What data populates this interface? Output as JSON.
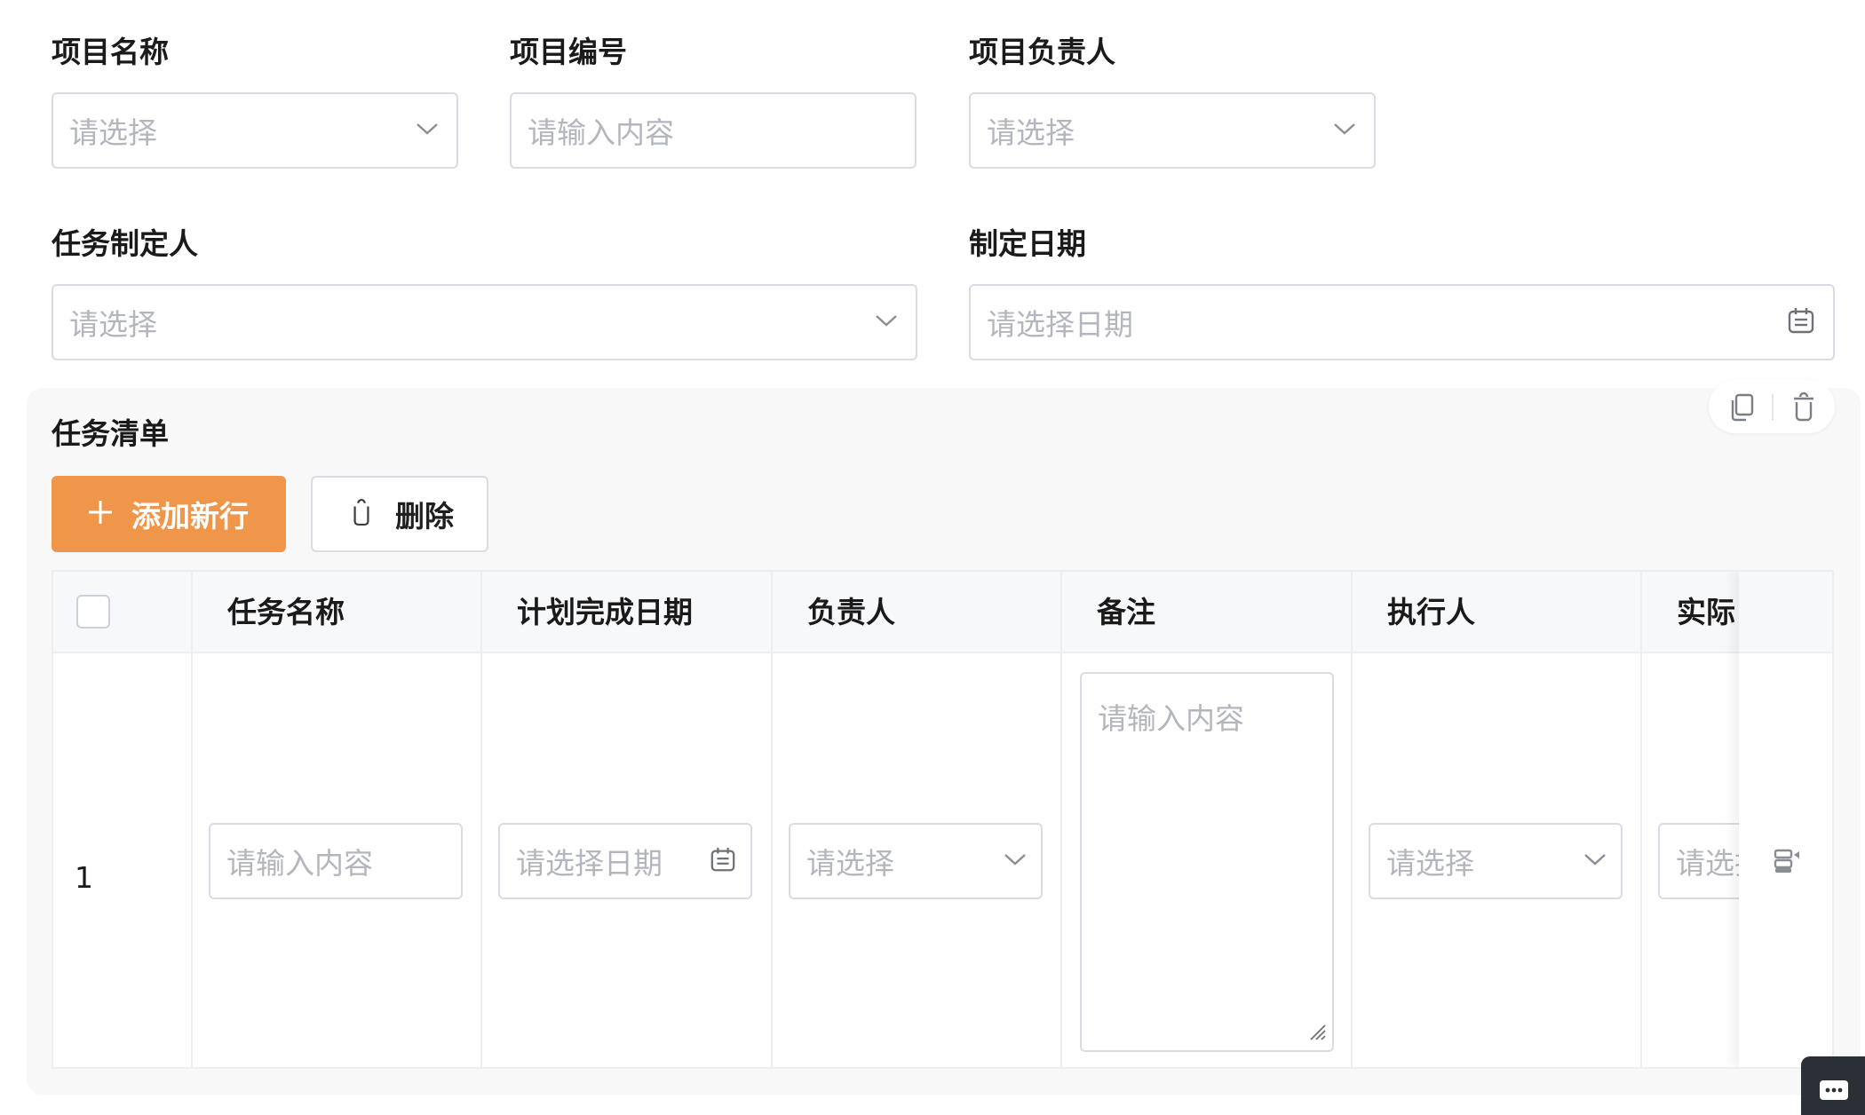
{
  "form": {
    "project_name": {
      "label": "项目名称",
      "placeholder": "请选择"
    },
    "project_code": {
      "label": "项目编号",
      "placeholder": "请输入内容"
    },
    "project_owner": {
      "label": "项目负责人",
      "placeholder": "请选择"
    },
    "task_creator": {
      "label": "任务制定人",
      "placeholder": "请选择"
    },
    "create_date": {
      "label": "制定日期",
      "placeholder": "请选择日期"
    }
  },
  "task_list": {
    "title": "任务清单",
    "add_button": "添加新行",
    "delete_button": "删除",
    "columns": [
      "任务名称",
      "计划完成日期",
      "负责人",
      "备注",
      "执行人",
      "实际"
    ],
    "rows": [
      {
        "index": "1",
        "task_name_placeholder": "请输入内容",
        "plan_date_placeholder": "请选择日期",
        "owner_placeholder": "请选择",
        "remark_placeholder": "请输入内容",
        "executor_placeholder": "请选择",
        "actual_placeholder": "请选择"
      }
    ]
  },
  "colors": {
    "accent": "#f0964a",
    "border": "#d9dce3",
    "placeholder": "#b3b6bd",
    "card_bg": "#f8f8f9"
  },
  "icons": [
    "chevron-down-icon",
    "calendar-icon",
    "copy-icon",
    "trash-icon",
    "plus-icon",
    "row-action-icon",
    "chat-icon"
  ]
}
